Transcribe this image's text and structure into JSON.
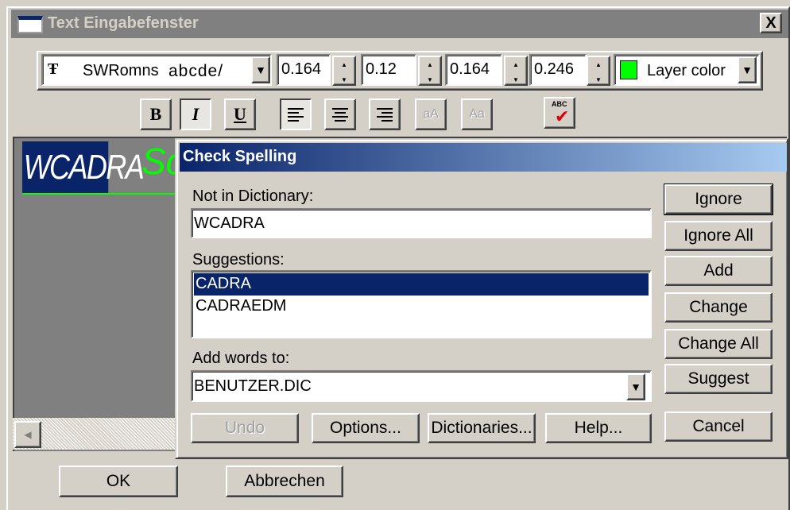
{
  "window": {
    "title": "Text Eingabefenster",
    "close_label": "X"
  },
  "toolbar": {
    "font_icon": "Ŧ",
    "font_name": "SWRomns",
    "font_preview": "abcde/",
    "spin_values": [
      "0.164",
      "0.12",
      "0.164",
      "0.246"
    ],
    "layer_color_label": "Layer color",
    "layer_color": "#00ff00",
    "bold_label": "B",
    "italic_label": "I",
    "underline_label": "U",
    "small_caps_label": "aA",
    "case_label": "Aa",
    "spell_icon_label": "ABC"
  },
  "editor": {
    "selected_text": "WCADRA",
    "trailing_text": "Sc"
  },
  "dialog": {
    "title": "Check Spelling",
    "not_in_dictionary_label": "Not in Dictionary:",
    "not_in_dictionary_value": "WCADRA",
    "suggestions_label": "Suggestions:",
    "suggestions": [
      "CADRA",
      "CADRAEDM"
    ],
    "add_words_label": "Add words to:",
    "add_words_value": "BENUTZER.DIC",
    "buttons": {
      "ignore": "Ignore",
      "ignore_all": "Ignore All",
      "add": "Add",
      "change": "Change",
      "change_all": "Change All",
      "suggest": "Suggest",
      "cancel": "Cancel",
      "undo": "Undo",
      "options": "Options...",
      "dictionaries": "Dictionaries...",
      "help": "Help..."
    }
  },
  "footer": {
    "ok_label": "OK",
    "cancel_label": "Abbrechen"
  }
}
